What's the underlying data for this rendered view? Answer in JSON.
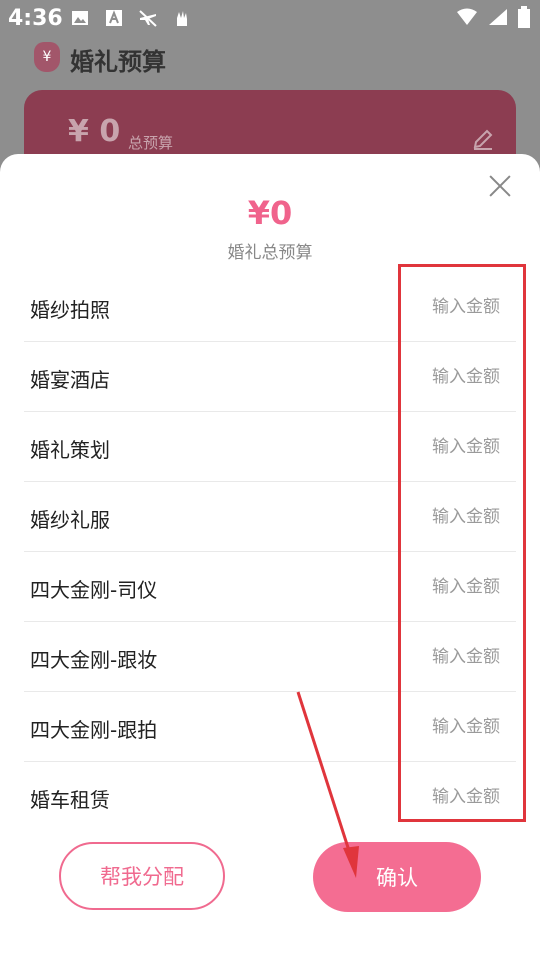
{
  "status_bar": {
    "time": "4:36",
    "left_icons": [
      "image-icon",
      "font-icon",
      "airplane-off-icon",
      "gesture-icon"
    ],
    "right_icons": [
      "wifi-icon",
      "signal-icon",
      "battery-icon"
    ]
  },
  "background": {
    "title": "婚礼预算",
    "amount": "¥ 0",
    "amount_label": "总预算",
    "logo_symbol": "¥"
  },
  "sheet": {
    "total_amount": "¥0",
    "total_label": "婚礼总预算",
    "input_placeholder": "输入金额",
    "items": [
      {
        "label": "婚纱拍照",
        "value": ""
      },
      {
        "label": "婚宴酒店",
        "value": ""
      },
      {
        "label": "婚礼策划",
        "value": ""
      },
      {
        "label": "婚纱礼服",
        "value": ""
      },
      {
        "label": "四大金刚-司仪",
        "value": ""
      },
      {
        "label": "四大金刚-跟妆",
        "value": ""
      },
      {
        "label": "四大金刚-跟拍",
        "value": ""
      },
      {
        "label": "婚车租赁",
        "value": ""
      }
    ],
    "auto_button": "帮我分配",
    "confirm_button": "确认"
  },
  "colors": {
    "accent": "#f46d92",
    "annotation": "#e0353c"
  }
}
